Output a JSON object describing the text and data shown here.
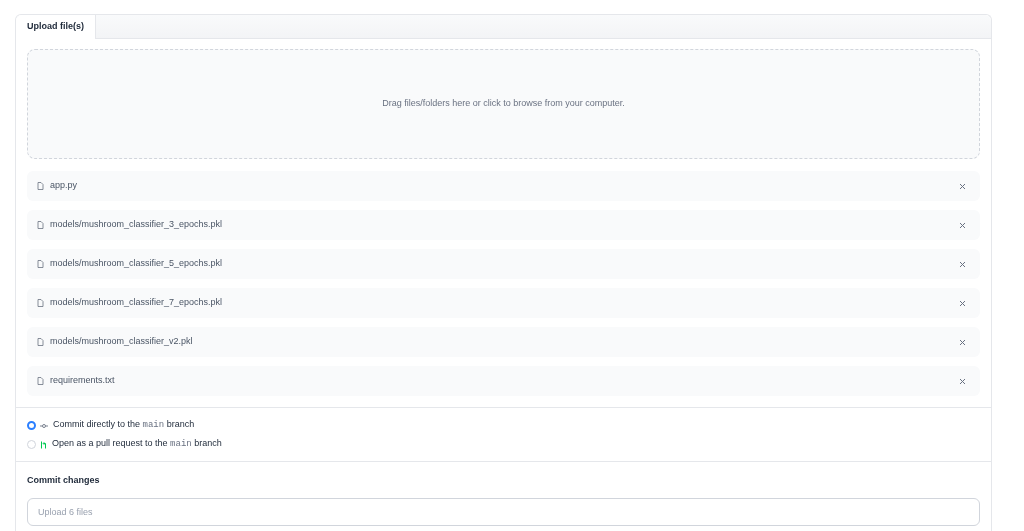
{
  "tabs": [
    {
      "label": "Upload file(s)",
      "selected": true
    }
  ],
  "dropzone": {
    "text": "Drag files/folders here or click to browse from your computer."
  },
  "files": [
    {
      "name": "app.py"
    },
    {
      "name": "models/mushroom_classifier_3_epochs.pkl"
    },
    {
      "name": "models/mushroom_classifier_5_epochs.pkl"
    },
    {
      "name": "models/mushroom_classifier_7_epochs.pkl"
    },
    {
      "name": "models/mushroom_classifier_v2.pkl"
    },
    {
      "name": "requirements.txt"
    }
  ],
  "commit_options": [
    {
      "kind": "commit",
      "before": "Commit directly to the",
      "code": "main",
      "after": "branch",
      "selected": true
    },
    {
      "kind": "pull_request",
      "before": "Open as a pull request to the",
      "code": "main",
      "after": "branch",
      "selected": false
    }
  ],
  "commit_changes": {
    "title": "Commit changes",
    "placeholder": "Upload 6 files"
  }
}
